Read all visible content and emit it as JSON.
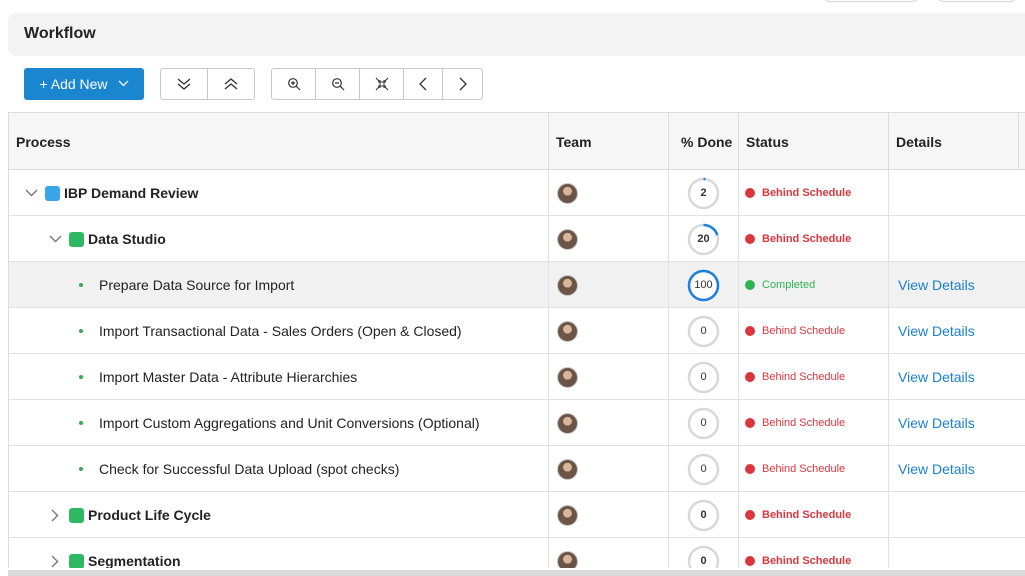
{
  "header": {
    "title": "Workflow"
  },
  "toolbar": {
    "add_new_label": "+ Add New",
    "buttons": [
      "expand-all",
      "collapse-all",
      "zoom-in",
      "zoom-out",
      "fit",
      "previous",
      "next"
    ]
  },
  "columns": {
    "process": "Process",
    "team": "Team",
    "done": "% Done",
    "status": "Status",
    "details": "Details"
  },
  "colors": {
    "accent": "#1a86d0",
    "behind": "#d9363e",
    "completed": "#2fb454",
    "blue_square": "#3aa5e8",
    "green_square": "#2fb864"
  },
  "rows": [
    {
      "name": "IBP Demand Review",
      "level": 0,
      "toggle": "expanded",
      "square": "blue",
      "done": "2",
      "pct": 0.02,
      "status": "Behind Schedule",
      "state": "behind",
      "details": ""
    },
    {
      "name": "Data Studio",
      "level": 1,
      "toggle": "expanded",
      "square": "green",
      "done": "20",
      "pct": 0.2,
      "status": "Behind Schedule",
      "state": "behind",
      "details": ""
    },
    {
      "name": "Prepare Data Source for Import",
      "level": 2,
      "toggle": "leaf",
      "square": "",
      "done": "100",
      "pct": 1.0,
      "status": "Completed",
      "state": "completed",
      "details": "View Details"
    },
    {
      "name": "Import Transactional Data - Sales Orders (Open & Closed)",
      "level": 2,
      "toggle": "leaf",
      "square": "",
      "done": "0",
      "pct": 0,
      "status": "Behind Schedule",
      "state": "behind",
      "details": "View Details"
    },
    {
      "name": "Import Master Data - Attribute Hierarchies",
      "level": 2,
      "toggle": "leaf",
      "square": "",
      "done": "0",
      "pct": 0,
      "status": "Behind Schedule",
      "state": "behind",
      "details": "View Details"
    },
    {
      "name": "Import Custom Aggregations and Unit Conversions (Optional)",
      "level": 2,
      "toggle": "leaf",
      "square": "",
      "done": "0",
      "pct": 0,
      "status": "Behind Schedule",
      "state": "behind",
      "details": "View Details"
    },
    {
      "name": "Check for Successful Data Upload (spot checks)",
      "level": 2,
      "toggle": "leaf",
      "square": "",
      "done": "0",
      "pct": 0,
      "status": "Behind Schedule",
      "state": "behind",
      "details": "View Details"
    },
    {
      "name": "Product Life Cycle",
      "level": 1,
      "toggle": "collapsed",
      "square": "green",
      "done": "0",
      "pct": 0,
      "status": "Behind Schedule",
      "state": "behind",
      "details": ""
    },
    {
      "name": "Segmentation",
      "level": 1,
      "toggle": "collapsed",
      "square": "green",
      "done": "0",
      "pct": 0,
      "status": "Behind Schedule",
      "state": "behind",
      "details": ""
    }
  ]
}
